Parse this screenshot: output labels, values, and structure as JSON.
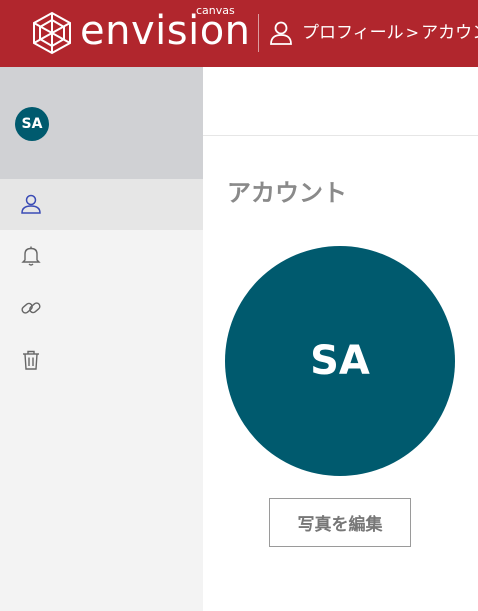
{
  "header": {
    "logo_text": "envision",
    "logo_sub": "canvas",
    "breadcrumb": {
      "first": "プロフィール",
      "separator": ">",
      "current": "アカウント"
    },
    "icons": {
      "logo": "envision-logo-mark",
      "user": "user-icon"
    }
  },
  "sidebar": {
    "avatar_initials": "SA",
    "items": [
      {
        "name": "account",
        "icon": "user-icon",
        "active": true
      },
      {
        "name": "notifications",
        "icon": "bell-icon",
        "active": false
      },
      {
        "name": "integrations",
        "icon": "link-icon",
        "active": false
      },
      {
        "name": "delete",
        "icon": "trash-icon",
        "active": false
      }
    ]
  },
  "main": {
    "title": "アカウント",
    "avatar_initials": "SA",
    "edit_photo_label": "写真を編集"
  },
  "colors": {
    "brand_red": "#b1262d",
    "avatar_teal": "#005a6e",
    "sidebar_bg": "#f3f3f3",
    "sidebar_header_bg": "#d0d1d4"
  }
}
